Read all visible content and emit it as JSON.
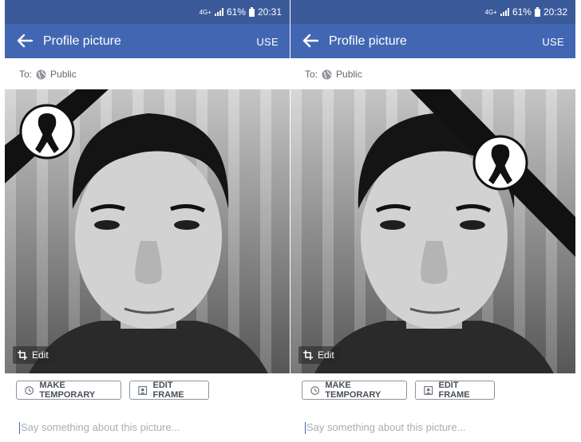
{
  "panels": [
    {
      "status": {
        "network": "4G+",
        "battery_pct": "61%",
        "time": "20:31"
      },
      "appbar": {
        "title": "Profile picture",
        "action": "USE"
      },
      "audience": {
        "prefix": "To:",
        "value": "Public"
      },
      "photo": {
        "edit_label": "Edit",
        "frame": "black-ribbon-top-left"
      },
      "buttons": {
        "make_temporary": "MAKE TEMPORARY",
        "edit_frame": "EDIT FRAME"
      },
      "caption": {
        "placeholder": "Say something about this picture..."
      }
    },
    {
      "status": {
        "network": "4G+",
        "battery_pct": "61%",
        "time": "20:32"
      },
      "appbar": {
        "title": "Profile picture",
        "action": "USE"
      },
      "audience": {
        "prefix": "To:",
        "value": "Public"
      },
      "photo": {
        "edit_label": "Edit",
        "frame": "black-ribbon-top-right"
      },
      "buttons": {
        "make_temporary": "MAKE TEMPORARY",
        "edit_frame": "EDIT FRAME"
      },
      "caption": {
        "placeholder": "Say something about this picture..."
      }
    }
  ],
  "colors": {
    "status_bar": "#3b5a9a",
    "app_bar": "#4267b2",
    "button_border": "#8d949e",
    "placeholder": "#a8adb6"
  }
}
